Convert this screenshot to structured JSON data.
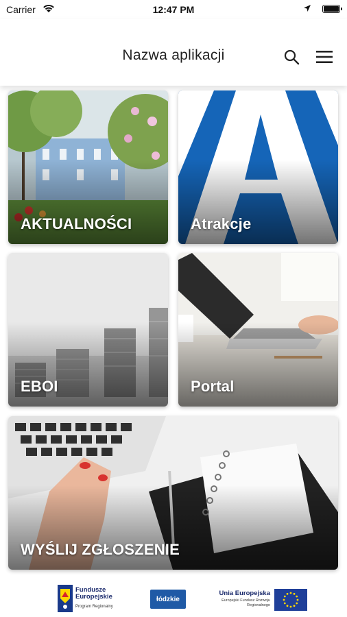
{
  "status_bar": {
    "carrier": "Carrier",
    "time": "12:47 PM",
    "icons": [
      "wifi-icon",
      "location-arrow-icon",
      "battery-icon"
    ]
  },
  "nav": {
    "title": "Nazwa aplikacji",
    "icons": [
      "search-icon",
      "hamburger-menu-icon"
    ]
  },
  "tiles": [
    {
      "label": "AKTUALNOŚCI"
    },
    {
      "label": "Atrakcje"
    },
    {
      "label": "EBOI"
    },
    {
      "label": "Portal"
    },
    {
      "label": "WYŚLIJ ZGŁOSZENIE"
    }
  ],
  "footer": {
    "fe_title": "Fundusze Europejskie",
    "fe_subtitle": "Program Regionalny",
    "region_logo_text": "łódzkie",
    "ue_title": "Unia Europejska",
    "ue_subtitle": "Europejski Fundusz Rozwoju Regionalnego"
  },
  "colors": {
    "accent_blue": "#1565b8",
    "ue_blue": "#1f3f99",
    "ue_star": "#ffd700"
  }
}
